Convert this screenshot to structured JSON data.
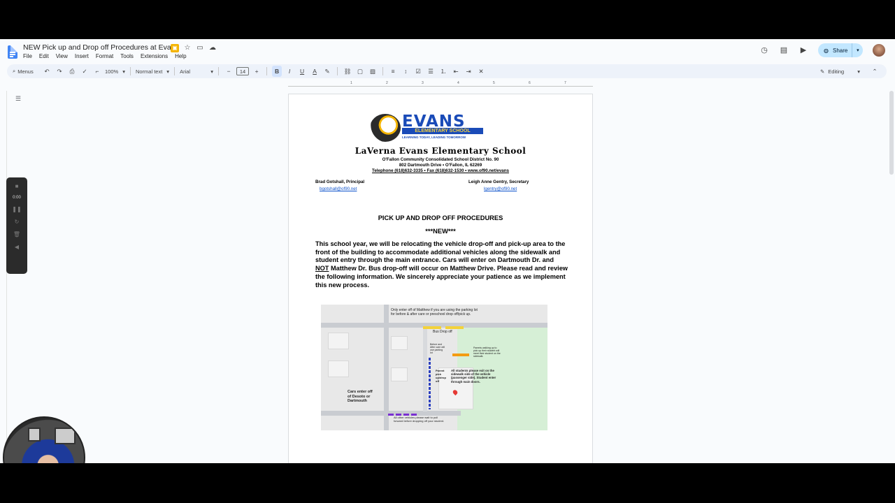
{
  "app": {
    "doc_title": "NEW Pick up and Drop off Procedures at Evans",
    "menus": [
      "File",
      "Edit",
      "View",
      "Insert",
      "Format",
      "Tools",
      "Extensions",
      "Help"
    ],
    "share_label": "Share"
  },
  "toolbar": {
    "menus_label": "Menus",
    "zoom": "100%",
    "style": "Normal text",
    "font": "Arial",
    "font_size": "14",
    "mode": "Editing"
  },
  "ruler": [
    "1",
    "2",
    "3",
    "4",
    "5",
    "6",
    "7"
  ],
  "recorder": {
    "time": "0:00"
  },
  "document": {
    "logo": {
      "word": "EVANS",
      "subtitle": "ELEMENTARY SCHOOL",
      "tagline": "LEARNING TODAY, LEADING TOMORROW"
    },
    "school_name": "LaVerna Evans Elementary School",
    "district": "O'Fallon Community Consolidated School District No. 90",
    "address": "802 Dartmouth Drive  •  O'Fallon, IL 62269",
    "phone_line": "Telephone (618)632-3335  •  Fax (618)632-1530  •  www.of90.net/evans",
    "principal": {
      "name": "Brad Gotshall, Principal",
      "email": "bgotshall@of90.net"
    },
    "secretary": {
      "name": "Leigh Anne Gentry, Secretary",
      "email": "lgentry@of90.net"
    },
    "heading": "PICK UP AND DROP OFF PROCEDURES",
    "new_marker": "***NEW***",
    "body_part1": "This school year, we will be relocating the vehicle drop-off and pick-up area to the front of the building to accommodate additional vehicles along the sidewalk and student entry through the main entrance. Cars will enter on Dartmouth Dr. and ",
    "body_not": "NOT",
    "body_part2": " Matthew Dr. Bus drop-off will occur on Matthew Drive. Please read and review the following information.  We sincerely appreciate your patience as we implement this new process.",
    "map_labels": {
      "enter_matthew": "Only enter off of Matthew if you are using the parking lot for before & after care or preschool drop off/pick up.",
      "bus": "Bus Drop off",
      "before_after": "Before and After care will use parking lot",
      "parents_walking": "Parents walking up to pick up their student will meet their student on the sidewalk.",
      "parent_pickup": "Parent pick up/drop off",
      "students_exit": "All students please exit on the sidewalk side of the vehicle (passenger side). Student enter through main doors.",
      "cars_enter": "Cars enter off of Desoto or Dartmouth",
      "other_vehicles": "All other vehicles please wait to pull forward before dropping off your student."
    }
  },
  "colors": {
    "accent": "#1a4bb8",
    "share_bg": "#c2e7ff",
    "toolbar_bg": "#edf2fa"
  }
}
